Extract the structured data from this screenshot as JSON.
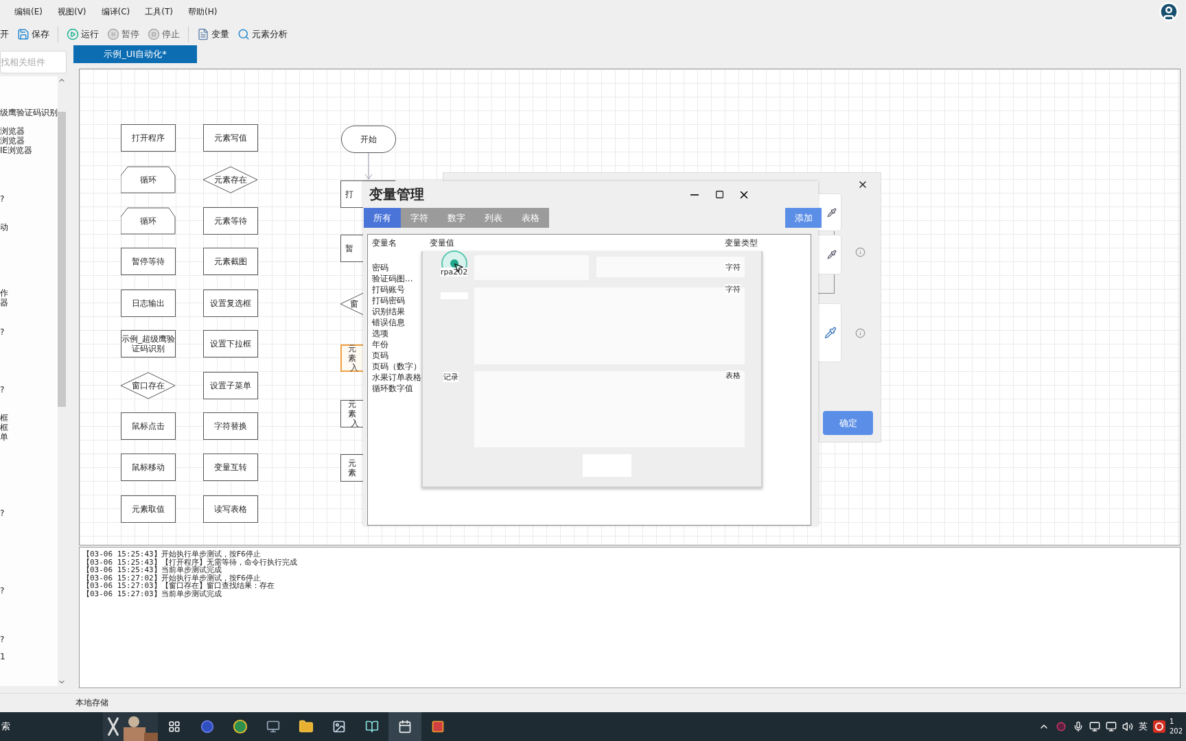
{
  "menu": [
    "编辑(E)",
    "视图(V)",
    "编译(C)",
    "工具(T)",
    "帮助(H)"
  ],
  "toolbar": [
    {
      "label": "开",
      "disabled": false
    },
    {
      "label": "保存",
      "disabled": false
    },
    {
      "label": "运行",
      "disabled": false
    },
    {
      "label": "暂停",
      "disabled": true
    },
    {
      "label": "停止",
      "disabled": true
    },
    {
      "label": "变量",
      "disabled": false
    },
    {
      "label": "元素分析",
      "disabled": false
    }
  ],
  "left_panel": {
    "search": {
      "placeholder": "找相关组件"
    },
    "items": [
      "级鹰验证码识别",
      "浏览器",
      "浏览器",
      "IE浏览器",
      "?",
      "动",
      "作",
      "器",
      "?",
      "?",
      "框",
      "框",
      "单",
      "?",
      "?",
      "?",
      "1"
    ]
  },
  "document_tab": {
    "label": "示例_UI自动化*",
    "selected": true
  },
  "palette": [
    {
      "lines": [
        "打开程序"
      ],
      "kind": "rect"
    },
    {
      "lines": [
        "元素写值"
      ],
      "kind": "rect"
    },
    {
      "lines": [
        "循环"
      ],
      "kind": "hexagon"
    },
    {
      "lines": [
        "元素存在"
      ],
      "kind": "diamond"
    },
    {
      "lines": [
        "循环"
      ],
      "kind": "hexagon"
    },
    {
      "lines": [
        "元素等待"
      ],
      "kind": "rect"
    },
    {
      "lines": [
        "暂停等待"
      ],
      "kind": "rect"
    },
    {
      "lines": [
        "元素截图"
      ],
      "kind": "rect"
    },
    {
      "lines": [
        "日志输出"
      ],
      "kind": "rect"
    },
    {
      "lines": [
        "设置复选框"
      ],
      "kind": "rect"
    },
    {
      "lines": [
        "示例_超级鹰验",
        "证码识别"
      ],
      "kind": "rect"
    },
    {
      "lines": [
        "设置下拉框"
      ],
      "kind": "rect"
    },
    {
      "lines": [
        "窗口存在"
      ],
      "kind": "diamond"
    },
    {
      "lines": [
        "设置子菜单"
      ],
      "kind": "rect"
    },
    {
      "lines": [
        "鼠标点击"
      ],
      "kind": "rect"
    },
    {
      "lines": [
        "字符替换"
      ],
      "kind": "rect"
    },
    {
      "lines": [
        "鼠标移动"
      ],
      "kind": "rect"
    },
    {
      "lines": [
        "变量互转"
      ],
      "kind": "rect"
    },
    {
      "lines": [
        "元素取值"
      ],
      "kind": "rect"
    },
    {
      "lines": [
        "读写表格"
      ],
      "kind": "rect"
    }
  ],
  "flow": [
    {
      "lines": [
        "开始"
      ],
      "kind": "start"
    },
    {
      "lines": [
        "打"
      ],
      "kind": "step",
      "selected": false
    },
    {
      "lines": [
        "暂"
      ],
      "kind": "step",
      "selected": false
    },
    {
      "lines": [
        "窗"
      ],
      "kind": "decision"
    },
    {
      "lines": [
        "元素",
        "入"
      ],
      "kind": "step",
      "selected": true
    },
    {
      "lines": [
        "元素",
        "入"
      ],
      "kind": "step",
      "selected": false
    },
    {
      "lines": [
        "元素"
      ],
      "kind": "step",
      "selected": false
    }
  ],
  "log": [
    "【03-06 15:25:43】开始执行单步测试，按F6停止",
    "【03-06 15:25:43】【打开程序】无需等待，命令行执行完成",
    "【03-06 15:25:43】当前单步测试完成",
    "【03-06 15:27:02】开始执行单步测试，按F6停止",
    "【03-06 15:27:03】【窗口存在】窗口查找结果：存在",
    "【03-06 15:27:03】当前单步测试完成"
  ],
  "status_bar": "本地存储",
  "back_dialog": {
    "confirm_button": "确定"
  },
  "variable_dialog": {
    "title": "变量管理",
    "tabs": [
      {
        "label": "所有",
        "selected": true
      },
      {
        "label": "字符",
        "selected": false
      },
      {
        "label": "数字",
        "selected": false
      },
      {
        "label": "列表",
        "selected": false
      },
      {
        "label": "表格",
        "selected": false
      }
    ],
    "add_button": "添加",
    "columns": [
      "变量名",
      "变量值",
      "变量类型"
    ],
    "names": [
      "密码",
      "验证码图...",
      "打码账号",
      "打码密码",
      "识别结果",
      "错误信息",
      "选项",
      "年份",
      "页码",
      "页码（数字）",
      "水果订单表格",
      "循环数字值"
    ]
  },
  "overlay_panel": {
    "value_fragments": [
      "rpa202",
      "记录"
    ],
    "type_fragments": [
      "字符",
      "字符",
      "表格"
    ]
  },
  "taskbar": {
    "search": "索",
    "language": "英",
    "clock": [
      "1",
      "202"
    ]
  }
}
